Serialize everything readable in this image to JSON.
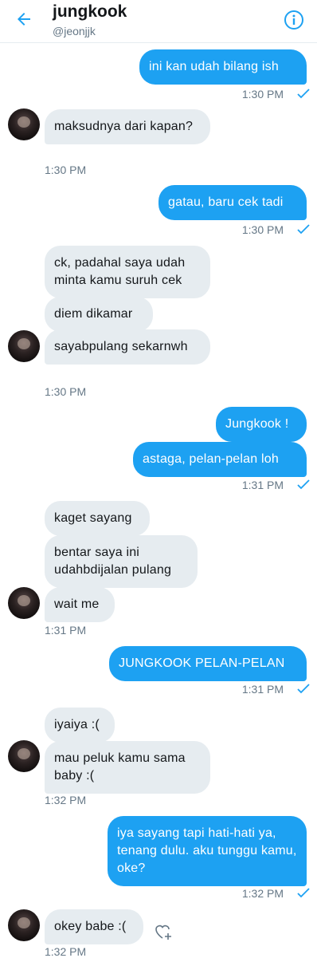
{
  "header": {
    "title": "jungkook",
    "handle": "@jeonjjk"
  },
  "messages": [
    {
      "text": "ini kan udah bilang ish"
    },
    {
      "text": "maksudnya dari kapan?"
    },
    {
      "text": "gatau, baru cek tadi"
    },
    {
      "text": "ck, padahal saya udah minta kamu suruh cek"
    },
    {
      "text": "diem dikamar"
    },
    {
      "text": "sayabpulang sekarnwh"
    },
    {
      "text": "Jungkook !"
    },
    {
      "text": "astaga, pelan-pelan loh"
    },
    {
      "text": "kaget sayang"
    },
    {
      "text": "bentar saya ini udahbdijalan pulang"
    },
    {
      "text": "wait me"
    },
    {
      "text": "JUNGKOOK PELAN-PELAN"
    },
    {
      "text": "iyaiya :("
    },
    {
      "text": "mau peluk kamu sama baby :("
    },
    {
      "text": "iya sayang tapi hati-hati ya, tenang dulu. aku tunggu kamu, oke?"
    },
    {
      "text": "okey babe :("
    }
  ],
  "timestamps": [
    "1:30 PM",
    "1:30 PM",
    "1:30 PM",
    "1:30 PM",
    "1:31 PM",
    "1:31 PM",
    "1:31 PM",
    "1:32 PM",
    "1:32 PM",
    "1:32 PM"
  ],
  "icons": {
    "back": "arrow-left-icon",
    "info": "info-icon",
    "read": "check-icon",
    "react": "heart-plus-icon"
  },
  "colors": {
    "accent": "#1da1f2",
    "incoming_bubble": "#e6ecf0",
    "meta_text": "#657786"
  }
}
